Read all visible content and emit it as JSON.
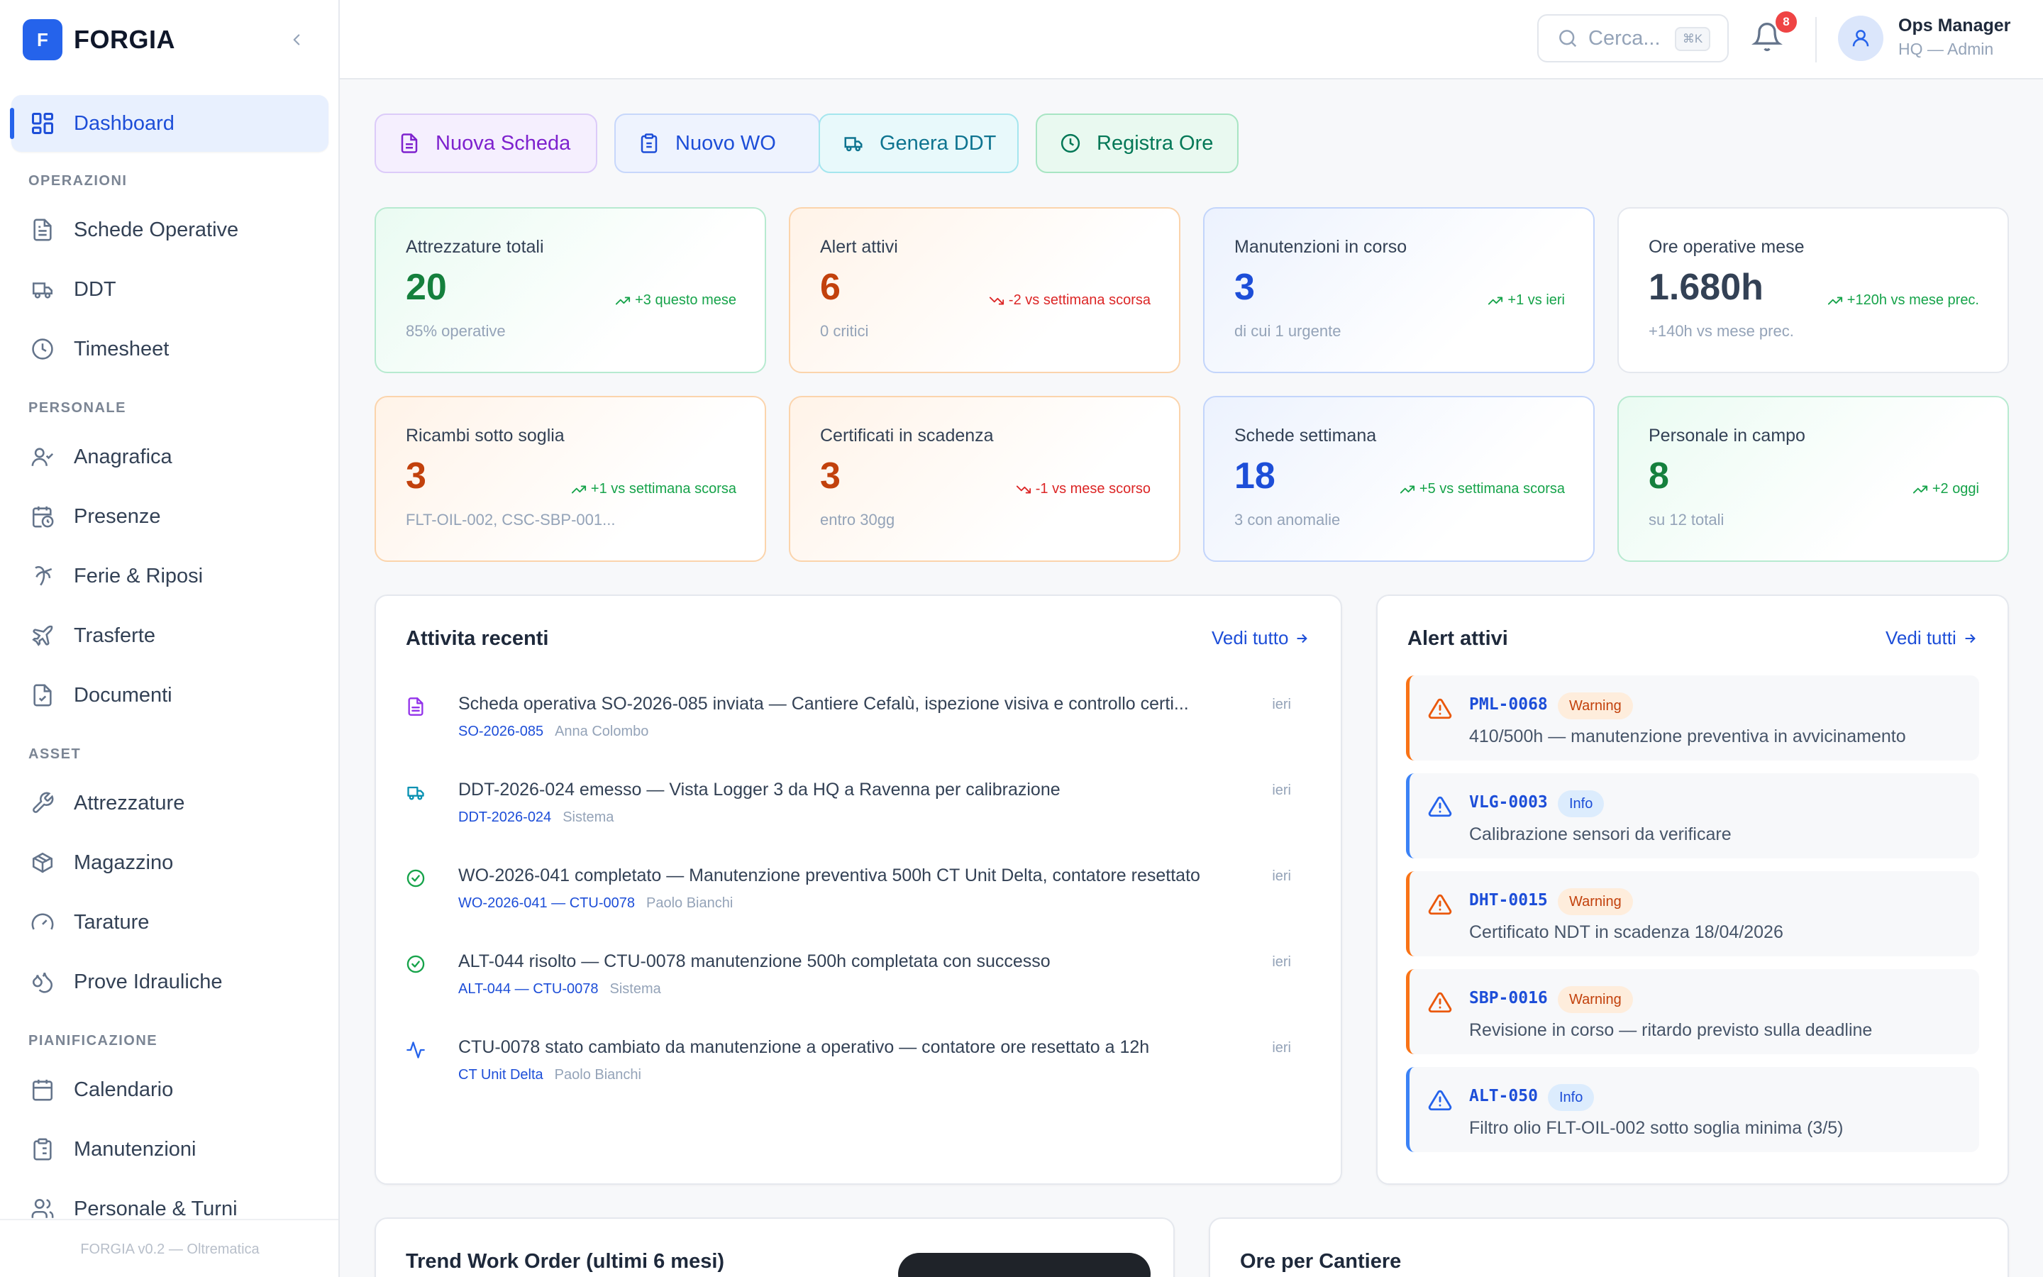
{
  "app": {
    "logo_letter": "F",
    "name": "FORGIA",
    "footer": "FORGIA v0.2 — Oltrematica",
    "accent": "#2563eb"
  },
  "sidebar": {
    "active": {
      "label": "Dashboard",
      "icon": "dashboard-icon"
    },
    "sections": [
      {
        "title": "OPERAZIONI",
        "items": [
          {
            "label": "Schede Operative",
            "icon": "document-icon"
          },
          {
            "label": "DDT",
            "icon": "truck-icon"
          },
          {
            "label": "Timesheet",
            "icon": "clock-icon"
          }
        ]
      },
      {
        "title": "PERSONALE",
        "items": [
          {
            "label": "Anagrafica",
            "icon": "user-check-icon"
          },
          {
            "label": "Presenze",
            "icon": "calendar-clock-icon"
          },
          {
            "label": "Ferie & Riposi",
            "icon": "palm-tree-icon"
          },
          {
            "label": "Trasferte",
            "icon": "plane-icon"
          },
          {
            "label": "Documenti",
            "icon": "file-check-icon"
          }
        ]
      },
      {
        "title": "ASSET",
        "items": [
          {
            "label": "Attrezzature",
            "icon": "wrench-icon"
          },
          {
            "label": "Magazzino",
            "icon": "package-icon"
          },
          {
            "label": "Tarature",
            "icon": "gauge-icon"
          },
          {
            "label": "Prove Idrauliche",
            "icon": "droplets-icon"
          }
        ]
      },
      {
        "title": "PIANIFICAZIONE",
        "items": [
          {
            "label": "Calendario",
            "icon": "calendar-icon"
          },
          {
            "label": "Manutenzioni",
            "icon": "clipboard-list-icon"
          },
          {
            "label": "Personale & Turni",
            "icon": "users-icon"
          }
        ]
      }
    ]
  },
  "header": {
    "search": {
      "placeholder": "Cerca...",
      "shortcut": "⌘K"
    },
    "notifications": {
      "count": "8"
    },
    "user": {
      "name": "Ops Manager",
      "role": "HQ — Admin"
    }
  },
  "quick_actions": [
    {
      "label": "Nuova Scheda",
      "icon": "document-icon"
    },
    {
      "label": "Nuovo WO",
      "icon": "clipboard-icon"
    },
    {
      "label": "Genera DDT",
      "icon": "truck-icon"
    },
    {
      "label": "Registra Ore",
      "icon": "clock-icon"
    }
  ],
  "stats": [
    {
      "label": "Attrezzature totali",
      "value": "20",
      "sub": "85% operative",
      "trend": "+3 questo mese",
      "dir": "up",
      "value_color": "#15803d"
    },
    {
      "label": "Alert attivi",
      "value": "6",
      "sub": "0 critici",
      "trend": "-2 vs settimana scorsa",
      "dir": "down",
      "value_color": "#c2410c"
    },
    {
      "label": "Manutenzioni in corso",
      "value": "3",
      "sub": "di cui 1 urgente",
      "trend": "+1 vs ieri",
      "dir": "up",
      "value_color": "#1d4ed8"
    },
    {
      "label": "Ore operative mese",
      "value": "1.680h",
      "sub": "+140h vs mese prec.",
      "trend": "+120h vs mese prec.",
      "dir": "up",
      "value_color": "#334155"
    },
    {
      "label": "Ricambi sotto soglia",
      "value": "3",
      "sub": "FLT-OIL-002, CSC-SBP-001...",
      "trend": "+1 vs settimana scorsa",
      "dir": "up",
      "value_color": "#c2410c"
    },
    {
      "label": "Certificati in scadenza",
      "value": "3",
      "sub": "entro 30gg",
      "trend": "-1 vs mese scorso",
      "dir": "down",
      "value_color": "#c2410c"
    },
    {
      "label": "Schede settimana",
      "value": "18",
      "sub": "3 con anomalie",
      "trend": "+5 vs settimana scorsa",
      "dir": "up",
      "value_color": "#1d4ed8"
    },
    {
      "label": "Personale in campo",
      "value": "8",
      "sub": "su 12 totali",
      "trend": "+2 oggi",
      "dir": "up",
      "value_color": "#15803d"
    }
  ],
  "activity": {
    "title": "Attivita recenti",
    "see_all": "Vedi tutto",
    "items": [
      {
        "icon": "document-icon",
        "icon_color": "#9333ea",
        "text": "Scheda operativa SO-2026-085 inviata — Cantiere Cefalù, ispezione visiva e controllo certi...",
        "ref": "SO-2026-085",
        "who": "Anna Colombo",
        "when": "ieri"
      },
      {
        "icon": "truck-icon",
        "icon_color": "#0891b2",
        "text": "DDT-2026-024 emesso — Vista Logger 3 da HQ a Ravenna per calibrazione",
        "ref": "DDT-2026-024",
        "who": "Sistema",
        "when": "ieri"
      },
      {
        "icon": "check-circle-icon",
        "icon_color": "#16a34a",
        "text": "WO-2026-041 completato — Manutenzione preventiva 500h CT Unit Delta, contatore resettato",
        "ref": "WO-2026-041 — CTU-0078",
        "who": "Paolo Bianchi",
        "when": "ieri"
      },
      {
        "icon": "check-circle-icon",
        "icon_color": "#16a34a",
        "text": "ALT-044 risolto — CTU-0078 manutenzione 500h completata con successo",
        "ref": "ALT-044 — CTU-0078",
        "who": "Sistema",
        "when": "ieri"
      },
      {
        "icon": "activity-icon",
        "icon_color": "#2563eb",
        "text": "CTU-0078 stato cambiato da manutenzione a operativo — contatore ore resettato a 12h",
        "ref": "CT Unit Delta",
        "who": "Paolo Bianchi",
        "when": "ieri"
      }
    ]
  },
  "alerts": {
    "title": "Alert attivi",
    "see_all": "Vedi tutti",
    "items": [
      {
        "code": "PML-0068",
        "level": "Warning",
        "type": "warn",
        "msg": "410/500h — manutenzione preventiva in avvicinamento"
      },
      {
        "code": "VLG-0003",
        "level": "Info",
        "type": "info",
        "msg": "Calibrazione sensori da verificare"
      },
      {
        "code": "DHT-0015",
        "level": "Warning",
        "type": "warn",
        "msg": "Certificato NDT in scadenza 18/04/2026"
      },
      {
        "code": "SBP-0016",
        "level": "Warning",
        "type": "warn",
        "msg": "Revisione in corso — ritardo previsto sulla deadline"
      },
      {
        "code": "ALT-050",
        "level": "Info",
        "type": "info",
        "msg": "Filtro olio FLT-OIL-002 sotto soglia minima (3/5)"
      }
    ]
  },
  "bottom_panels": [
    {
      "title": "Trend Work Order (ultimi 6 mesi)"
    },
    {
      "title": "Ore per Cantiere"
    }
  ]
}
